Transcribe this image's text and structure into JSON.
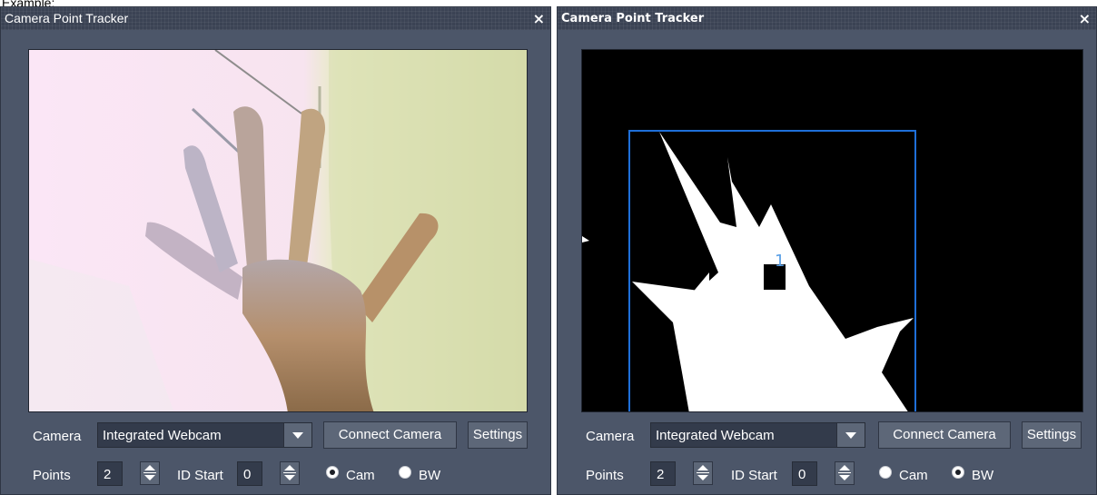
{
  "caption": "Example:",
  "windows": [
    {
      "title": "Camera Point Tracker",
      "close_glyph": "×",
      "view_mode": "camera",
      "labels": {
        "camera": "Camera",
        "points": "Points",
        "id_start": "ID Start",
        "cam": "Cam",
        "bw": "BW"
      },
      "camera_select": "Integrated Webcam",
      "connect_button": "Connect Camera",
      "settings_button": "Settings",
      "points_value": "2",
      "id_start_value": "0",
      "selected_radio": "Cam"
    },
    {
      "title": "Camera Point Tracker",
      "close_glyph": "×",
      "view_mode": "bw",
      "tracked_point_label": "1",
      "labels": {
        "camera": "Camera",
        "points": "Points",
        "id_start": "ID Start",
        "cam": "Cam",
        "bw": "BW"
      },
      "camera_select": "Integrated Webcam",
      "connect_button": "Connect Camera",
      "settings_button": "Settings",
      "points_value": "2",
      "id_start_value": "0",
      "selected_radio": "BW"
    }
  ],
  "colors": {
    "window_bg": "#4c5669",
    "button_bg": "#5d6778",
    "tracking_box": "#1e6fd9"
  }
}
